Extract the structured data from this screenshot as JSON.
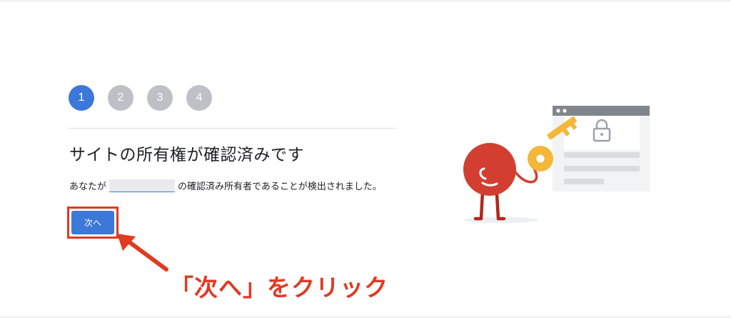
{
  "steps": [
    {
      "label": "1",
      "active": true
    },
    {
      "label": "2",
      "active": false
    },
    {
      "label": "3",
      "active": false
    },
    {
      "label": "4",
      "active": false
    }
  ],
  "verification": {
    "title": "サイトの所有権が確認済みです",
    "desc_prefix": "あなたが",
    "desc_suffix": "の確認済み所有者であることが検出されました。",
    "next_button": "次へ"
  },
  "annotation": {
    "text": "「次へ」をクリック"
  },
  "icons": [
    "lock-icon",
    "key-icon"
  ],
  "colors": {
    "accent": "#3c78d8",
    "step_inactive": "#bdc1c6",
    "highlight": "#e03a22",
    "mascot": "#d23f31",
    "key": "#f3b83a"
  }
}
